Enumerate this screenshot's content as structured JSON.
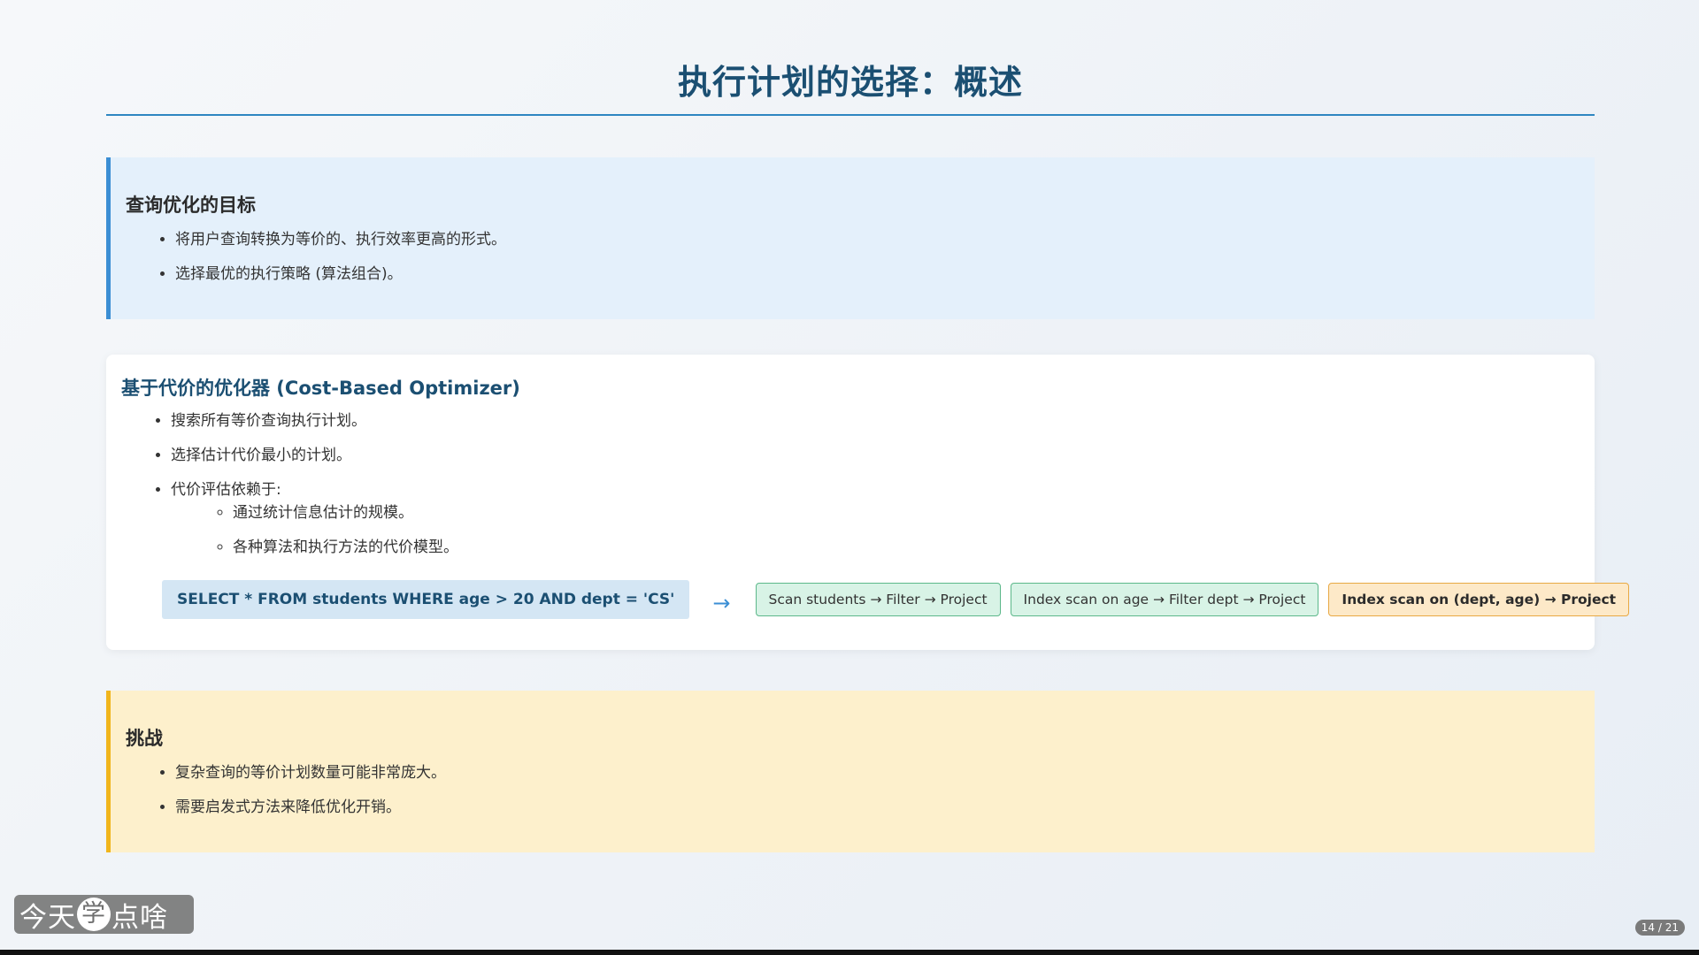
{
  "slide": {
    "title": "执行计划的选择：概述",
    "page_indicator": "14 / 21"
  },
  "goals": {
    "heading": "查询优化的目标",
    "items": [
      "将用户查询转换为等价的、执行效率更高的形式。",
      "选择最优的执行策略 (算法组合)。"
    ]
  },
  "cbo": {
    "heading": "基于代价的优化器 (Cost-Based Optimizer)",
    "items": [
      "搜索所有等价查询执行计划。",
      "选择估计代价最小的计划。",
      "代价评估依赖于:"
    ],
    "sub_items": [
      "通过统计信息估计的规模。",
      "各种算法和执行方法的代价模型。"
    ],
    "sql": "SELECT * FROM students WHERE age > 20 AND dept = 'CS'",
    "arrow": "→",
    "plans": [
      "Scan students → Filter → Project",
      "Index scan on age → Filter dept → Project",
      "Index scan on (dept, age) → Project"
    ]
  },
  "challenge": {
    "heading": "挑战",
    "items": [
      "复杂查询的等价计划数量可能非常庞大。",
      "需要启发式方法来降低优化开销。"
    ]
  },
  "watermark": {
    "text_before": "今天",
    "ring_char": "学",
    "text_after": "点啥"
  },
  "colors": {
    "title": "#1b4f72",
    "rule": "#2e86c1",
    "goal_accent": "#3b8ed4",
    "challenge_accent": "#f1b51c",
    "plan_green": "#d8f3e6",
    "plan_best": "#fde9c8"
  }
}
